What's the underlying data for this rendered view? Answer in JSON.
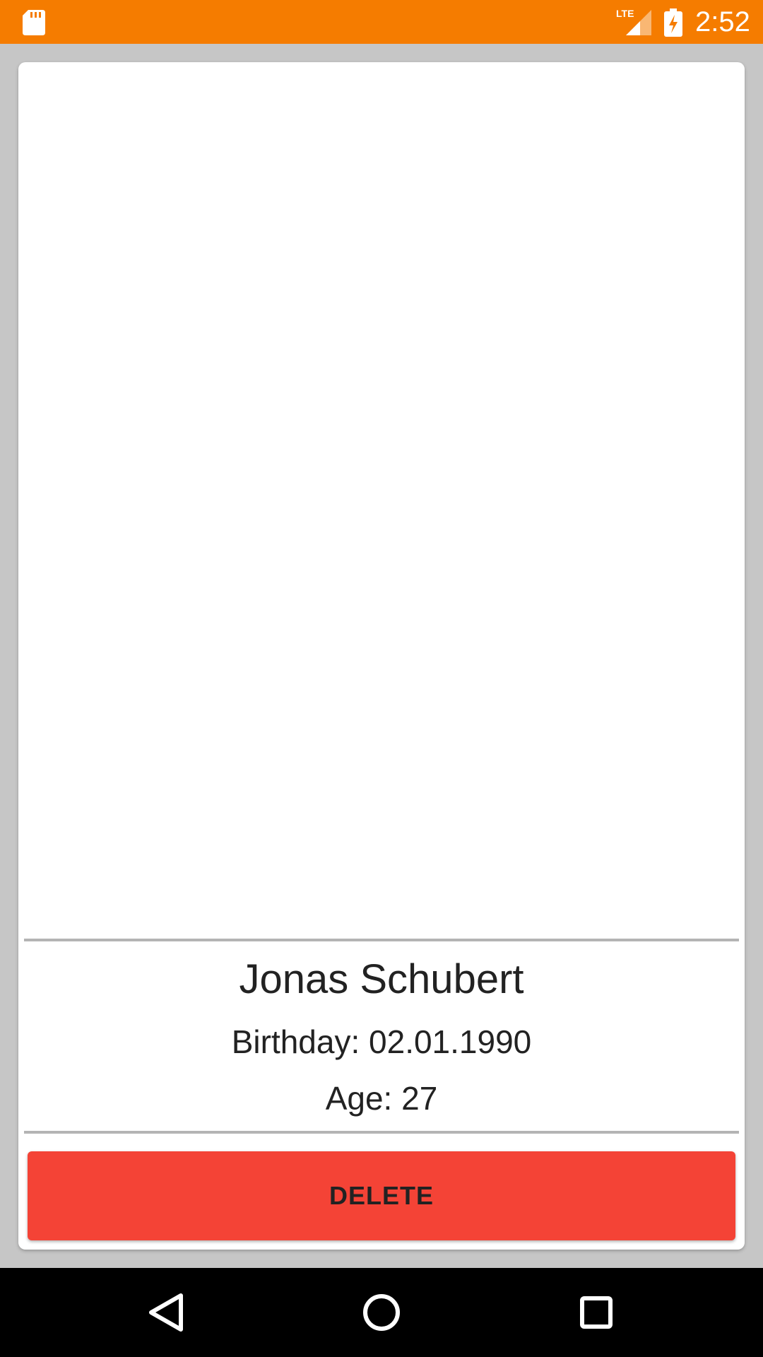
{
  "status_bar": {
    "time": "2:52",
    "network_label": "LTE",
    "background_color": "#f57c00",
    "icons": [
      "sd-card-icon",
      "lte-signal-icon",
      "battery-charging-icon"
    ]
  },
  "profile": {
    "name": "Jonas Schubert",
    "birthday_text": "Birthday: 02.01.1990",
    "age_text": "Age: 27"
  },
  "actions": {
    "delete_label": "DELETE",
    "delete_color": "#f44336"
  },
  "nav_bar": {
    "icons": [
      "back-icon",
      "home-icon",
      "recents-icon"
    ]
  }
}
